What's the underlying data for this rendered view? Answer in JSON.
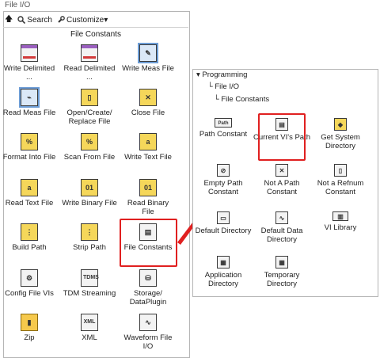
{
  "window": {
    "title": "File I/O"
  },
  "toolbar": {
    "up_glyph": "🡅",
    "search_label": "Search",
    "customize_label": "Customize▾"
  },
  "palette": {
    "heading": "File Constants",
    "items": [
      {
        "label": "Write Delimited ...",
        "icon": "write-delimited-icon"
      },
      {
        "label": "Read Delimited ...",
        "icon": "read-delimited-icon"
      },
      {
        "label": "Write Meas File",
        "icon": "write-meas-file-icon"
      },
      {
        "label": "Read Meas File",
        "icon": "read-meas-file-icon"
      },
      {
        "label": "Open/Create/ Replace File",
        "icon": "open-file-icon"
      },
      {
        "label": "Close File",
        "icon": "close-file-icon"
      },
      {
        "label": "Format Into File",
        "icon": "format-into-file-icon"
      },
      {
        "label": "Scan From File",
        "icon": "scan-from-file-icon"
      },
      {
        "label": "Write Text File",
        "icon": "write-text-file-icon"
      },
      {
        "label": "Read Text File",
        "icon": "read-text-file-icon"
      },
      {
        "label": "Write Binary File",
        "icon": "write-binary-file-icon"
      },
      {
        "label": "Read Binary File",
        "icon": "read-binary-file-icon"
      },
      {
        "label": "Build Path",
        "icon": "build-path-icon"
      },
      {
        "label": "Strip Path",
        "icon": "strip-path-icon"
      },
      {
        "label": "File Constants",
        "icon": "file-constants-icon"
      },
      {
        "label": "Config File VIs",
        "icon": "config-file-icon"
      },
      {
        "label": "TDM Streaming",
        "icon": "tdm-streaming-icon"
      },
      {
        "label": "Storage/ DataPlugin",
        "icon": "storage-icon"
      },
      {
        "label": "Zip",
        "icon": "zip-icon"
      },
      {
        "label": "XML",
        "icon": "xml-icon"
      },
      {
        "label": "Waveform File I/O",
        "icon": "waveform-file-icon"
      }
    ]
  },
  "subpalette": {
    "breadcrumb": [
      "Programming",
      "File I/O",
      "File Constants"
    ],
    "items": [
      {
        "label": "Path Constant",
        "icon": "path-constant-icon"
      },
      {
        "label": "Current VI's Path",
        "icon": "current-vi-path-icon"
      },
      {
        "label": "Get System Directory",
        "icon": "get-system-directory-icon"
      },
      {
        "label": "Empty Path Constant",
        "icon": "empty-path-icon"
      },
      {
        "label": "Not A Path Constant",
        "icon": "not-a-path-icon"
      },
      {
        "label": "Not a Refnum Constant",
        "icon": "not-a-refnum-icon"
      },
      {
        "label": "Default Directory",
        "icon": "default-directory-icon"
      },
      {
        "label": "Default Data Directory",
        "icon": "default-data-directory-icon"
      },
      {
        "label": "VI Library",
        "icon": "vi-library-icon"
      },
      {
        "label": "Application Directory",
        "icon": "application-directory-icon"
      },
      {
        "label": "Temporary Directory",
        "icon": "temporary-directory-icon"
      }
    ]
  }
}
